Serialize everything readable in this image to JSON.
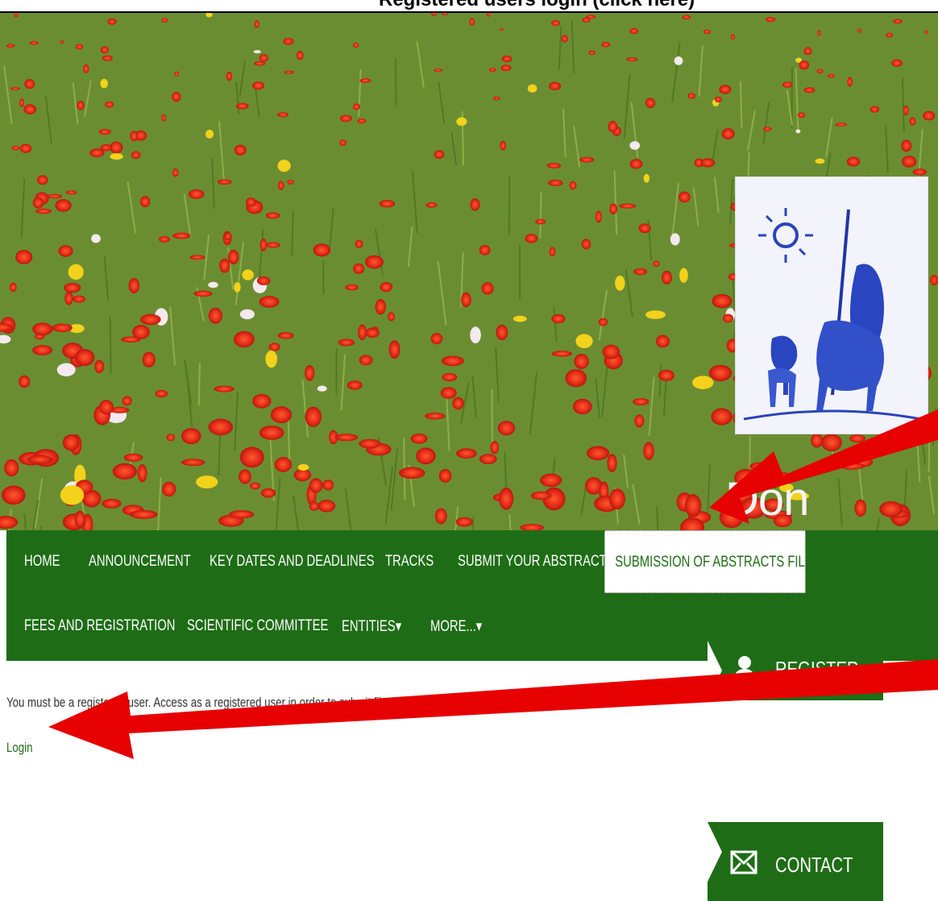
{
  "header": {
    "top_title": "Registered users login (click here)",
    "site_name": "Don Quixote"
  },
  "nav": {
    "items": [
      {
        "label": "HOME"
      },
      {
        "label": "ANNOUNCEMENT"
      },
      {
        "label": "KEY DATES AND DEADLINES"
      },
      {
        "label": "TRACKS"
      },
      {
        "label": "SUBMIT YOUR ABSTRACT"
      },
      {
        "label": "SUBMISSION OF ABSTRACTS FILES",
        "active": true
      },
      {
        "label": "FEES AND REGISTRATION"
      },
      {
        "label": "SCIENTIFIC COMMITTEE"
      },
      {
        "label": "ENTITIES▾"
      },
      {
        "label": "MORE...▾"
      }
    ]
  },
  "content": {
    "message": "You must be a registered user. Access as a registered user in order to submit files to the organizers.",
    "login_label": "Login"
  },
  "side": {
    "register_label": "REGISTER",
    "contact_label": "CONTACT"
  },
  "colors": {
    "nav_green": "#1e6d16",
    "arrow_red": "#e60000"
  }
}
